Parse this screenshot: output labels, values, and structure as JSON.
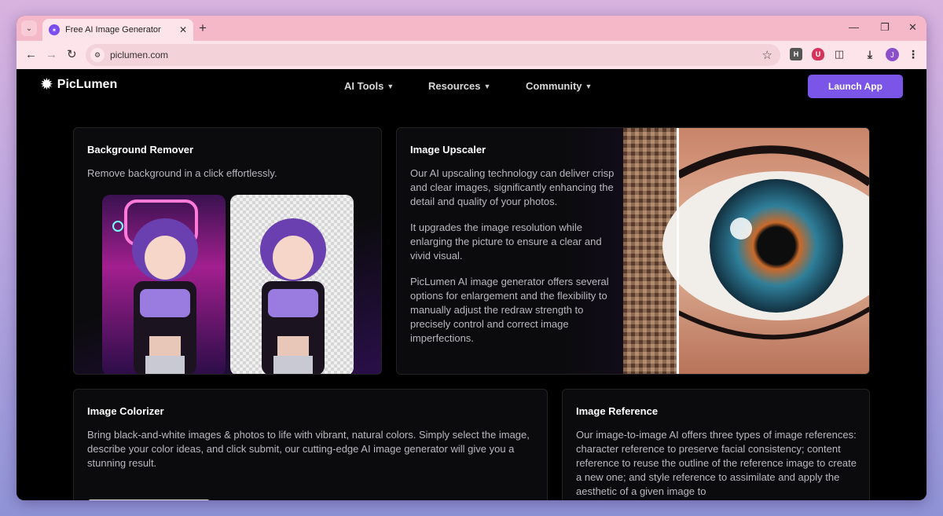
{
  "browser": {
    "tab_title": "Free AI Image Generator for AI",
    "url": "piclumen.com",
    "profile_initial": "J",
    "ext_h_label": "H"
  },
  "site": {
    "logo_text": "PicLumen",
    "nav": [
      {
        "label": "AI Tools"
      },
      {
        "label": "Resources"
      },
      {
        "label": "Community"
      }
    ],
    "launch_label": "Launch App"
  },
  "cards": {
    "bg_remover": {
      "title": "Background Remover",
      "text": "Remove background in a click effortlessly."
    },
    "upscaler": {
      "title": "Image Upscaler",
      "paragraphs": [
        "Our AI upscaling technology can deliver crisp and clear images, significantly enhancing the detail and quality of your photos.",
        "It upgrades the image resolution while enlarging the picture to ensure a clear and vivid visual.",
        "PicLumen AI image generator offers several options for enlargement and the flexibility to manually adjust the redraw strength to precisely control and correct image imperfections."
      ]
    },
    "colorizer": {
      "title": "Image Colorizer",
      "text": "Bring black-and-white images & photos to life with vibrant, natural colors. Simply select the image, describe your color ideas, and click submit, our cutting-edge AI image generator will give you a stunning result."
    },
    "reference": {
      "title": "Image Reference",
      "text": "Our image-to-image AI offers three types of image references: character reference to preserve facial consistency; content reference to reuse the outline of the reference image to create a new one; and style reference to assimilate and apply the aesthetic of a given image to"
    }
  },
  "colors": {
    "accent": "#7b55e8",
    "tab_bar": "#f5b8c8",
    "toolbar": "#fde4ea"
  }
}
